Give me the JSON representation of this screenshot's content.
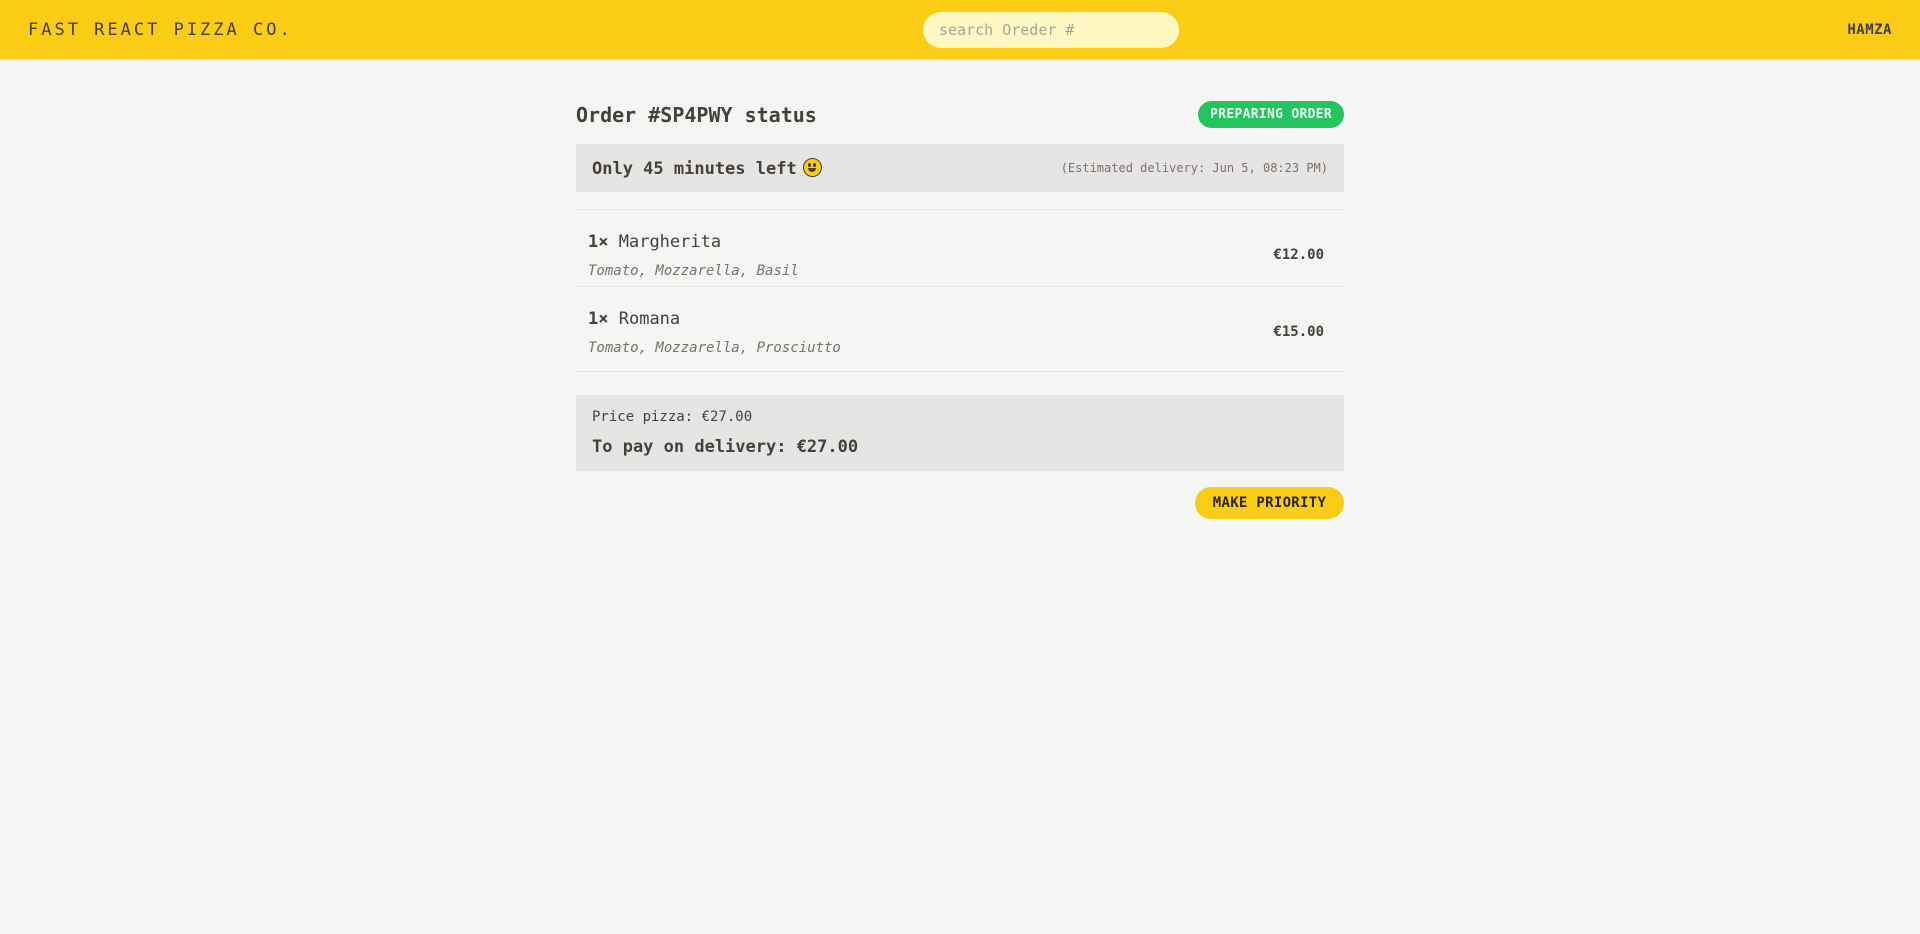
{
  "header": {
    "logo": "FAST REACT PIZZA CO.",
    "search_placeholder": "search Oreder #",
    "search_value": "",
    "username": "HAMZA"
  },
  "order": {
    "title": "Order #SP4PWY status",
    "status_badge": "PREPARING ORDER",
    "eta_text": "Only 45 minutes left",
    "eta_emoji": "smiley-face-icon",
    "estimated_delivery": "(Estimated delivery: Jun 5, 08:23 PM)",
    "items": [
      {
        "quantity": "1×",
        "name": "Margherita",
        "ingredients": "Tomato, Mozzarella, Basil",
        "price": "€12.00"
      },
      {
        "quantity": "1×",
        "name": "Romana",
        "ingredients": "Tomato, Mozzarella, Prosciutto",
        "price": "€15.00"
      }
    ],
    "price_pizza": "Price pizza: €27.00",
    "to_pay": "To pay on delivery: €27.00",
    "priority_button": "MAKE PRIORITY"
  },
  "colors": {
    "header_bg": "#facc15",
    "page_bg": "#f5f5f4",
    "status_green": "#22c55e",
    "panel_bg": "#e7e5e4",
    "search_bg": "#fef9c3"
  }
}
